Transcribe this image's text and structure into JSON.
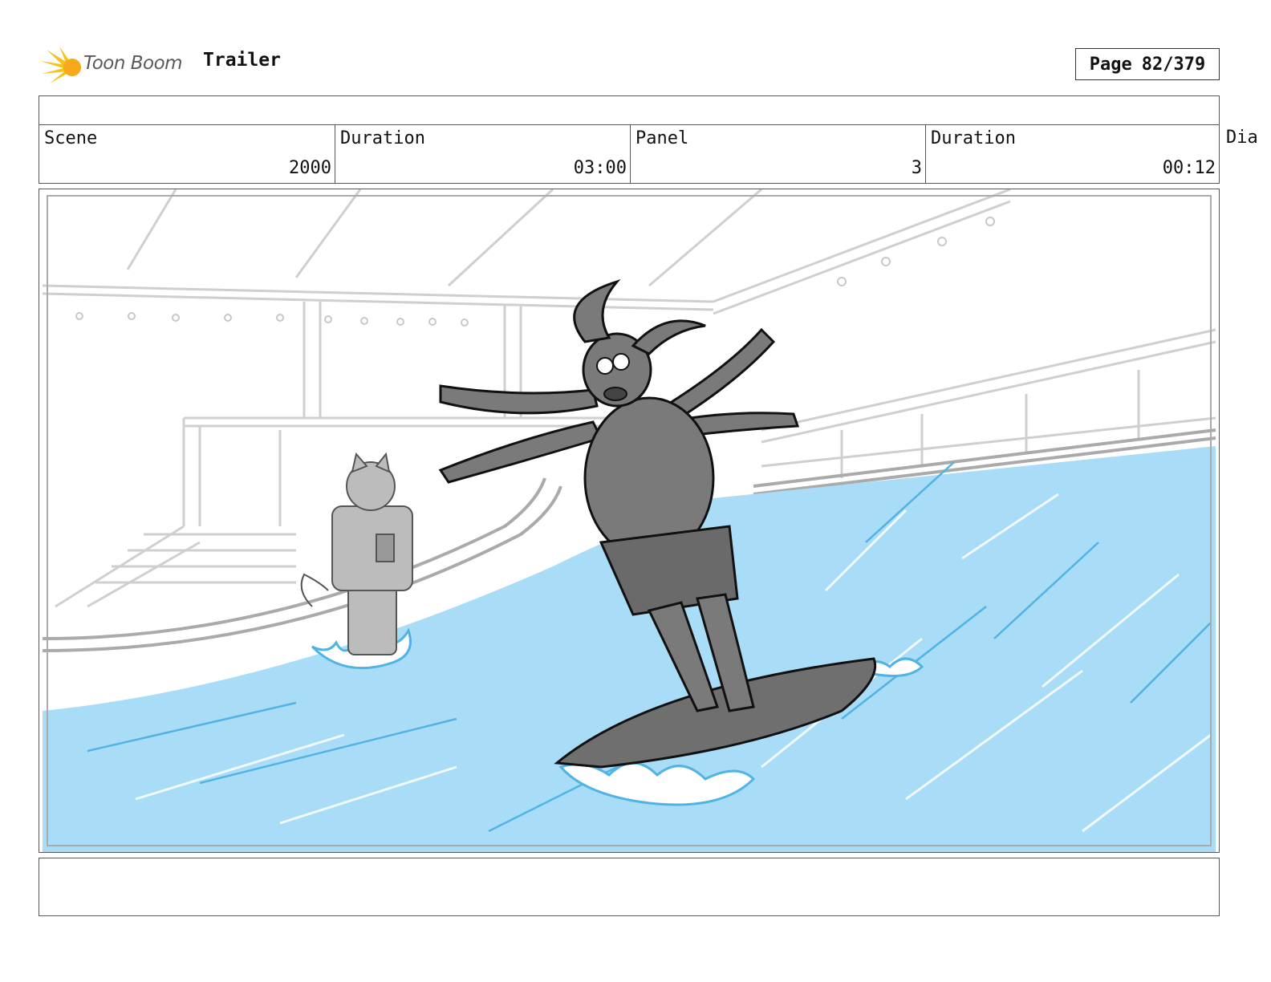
{
  "header": {
    "brand": "Toon Boom",
    "title": "Trailer",
    "page_label": "Page",
    "page_number": "82/379"
  },
  "info": {
    "scene_label": "Scene",
    "scene_value": "2000",
    "scene_duration_label": "Duration",
    "scene_duration_value": "03:00",
    "panel_label": "Panel",
    "panel_value": "3",
    "panel_duration_label": "Duration",
    "panel_duration_value": "00:12",
    "dialogue_label": "Dia"
  },
  "colors": {
    "water": "#a9dcf7",
    "water_stroke": "#4fb3e6",
    "character_fill": "#7a7a7a",
    "sketch_gray": "#cfcfcf",
    "logo_yellow": "#f5c31a"
  }
}
